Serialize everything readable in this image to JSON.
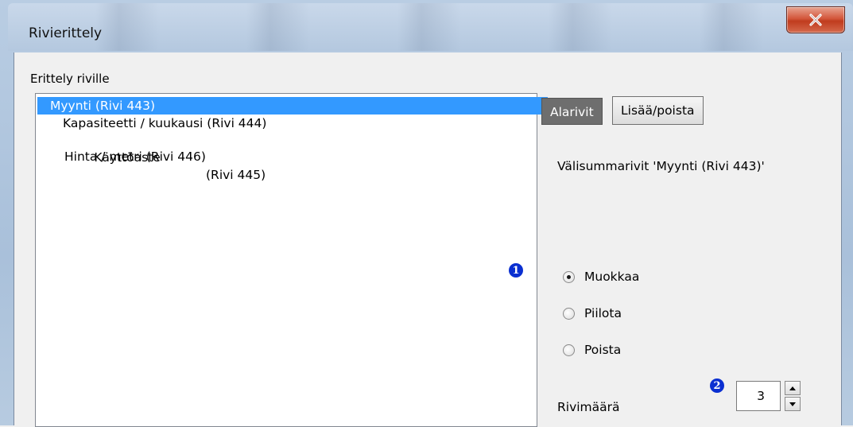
{
  "window": {
    "title": "Rivierittely",
    "close_symbol": "X"
  },
  "group_label": "Erittely riville",
  "list": {
    "items": [
      {
        "label": "Myynti (Rivi 443)",
        "selected": true
      },
      {
        "label": "Kapasiteetti / kuukausi (Rivi 444)",
        "selected": false
      },
      {
        "label": "Käyttöaste",
        "rownum": "(Rivi 445)",
        "selected": false
      },
      {
        "label": "Hinta / metri (Rivi 446)",
        "selected": false
      }
    ]
  },
  "tabs": [
    {
      "label": "Alarivit",
      "active": true
    },
    {
      "label": "Lisää/poista",
      "active": false
    }
  ],
  "subtitle": "Välisummarivit 'Myynti (Rivi 443)'",
  "options": [
    {
      "label": "Muokkaa",
      "checked": true
    },
    {
      "label": "Piilota",
      "checked": false
    },
    {
      "label": "Poista",
      "checked": false
    }
  ],
  "badges": {
    "one": "1",
    "two": "2"
  },
  "row_count": {
    "label": "Rivimäärä",
    "value": "3"
  },
  "colors": {
    "selection": "#3399ff",
    "badge": "#0a2fd1",
    "active_tab": "#6e6e6e",
    "close_button": "#c03c1e"
  }
}
